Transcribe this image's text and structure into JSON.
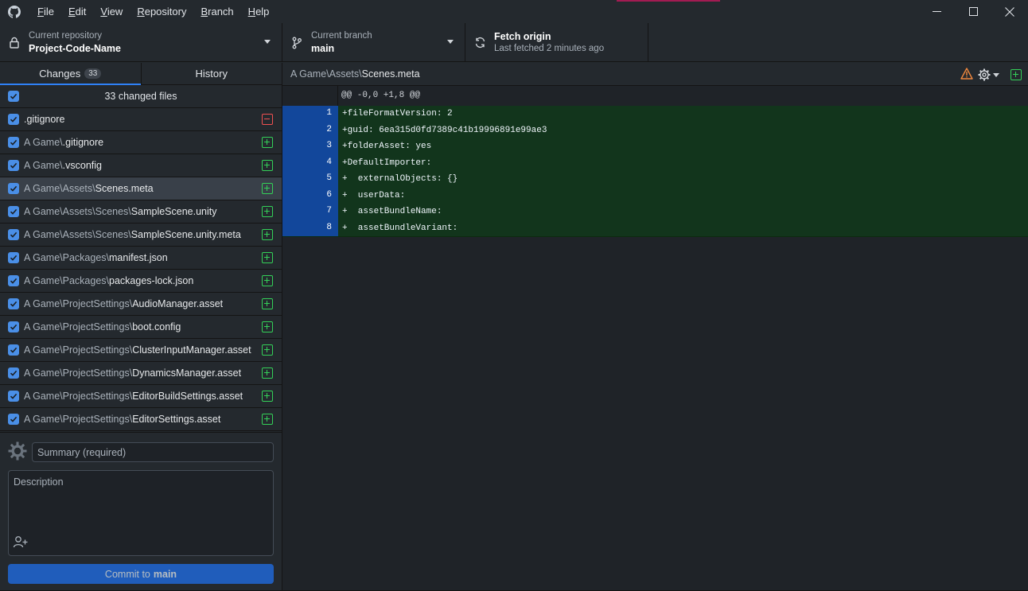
{
  "menu": {
    "items": [
      {
        "first": "F",
        "rest": "ile"
      },
      {
        "first": "E",
        "rest": "dit"
      },
      {
        "first": "V",
        "rest": "iew"
      },
      {
        "first": "R",
        "rest": "epository"
      },
      {
        "first": "B",
        "rest": "ranch"
      },
      {
        "first": "H",
        "rest": "elp"
      }
    ]
  },
  "toolbar": {
    "repo_label": "Current repository",
    "repo_value": "Project-Code-Name",
    "branch_label": "Current branch",
    "branch_value": "main",
    "fetch_label": "Fetch origin",
    "fetch_sub": "Last fetched 2 minutes ago"
  },
  "tabs": {
    "changes_label": "Changes",
    "changes_count": "33",
    "history_label": "History"
  },
  "files": {
    "header": "33 changed files",
    "items": [
      {
        "dir": "",
        "name": ".gitignore",
        "status": "deleted"
      },
      {
        "dir": "A Game\\",
        "name": ".gitignore",
        "status": "added"
      },
      {
        "dir": "A Game\\",
        "name": ".vsconfig",
        "status": "added"
      },
      {
        "dir": "A Game\\Assets\\",
        "name": "Scenes.meta",
        "status": "added",
        "selected": true
      },
      {
        "dir": "A Game\\Assets\\Scenes\\",
        "name": "SampleScene.unity",
        "status": "added"
      },
      {
        "dir": "A Game\\Assets\\Scenes\\",
        "name": "SampleScene.unity.meta",
        "status": "added"
      },
      {
        "dir": "A Game\\Packages\\",
        "name": "manifest.json",
        "status": "added"
      },
      {
        "dir": "A Game\\Packages\\",
        "name": "packages-lock.json",
        "status": "added"
      },
      {
        "dir": "A Game\\ProjectSettings\\",
        "name": "AudioManager.asset",
        "status": "added"
      },
      {
        "dir": "A Game\\ProjectSettings\\",
        "name": "boot.config",
        "status": "added"
      },
      {
        "dir": "A Game\\ProjectSettings\\",
        "name": "ClusterInputManager.asset",
        "status": "added"
      },
      {
        "dir": "A Game\\ProjectSettings\\",
        "name": "DynamicsManager.asset",
        "status": "added"
      },
      {
        "dir": "A Game\\ProjectSettings\\",
        "name": "EditorBuildSettings.asset",
        "status": "added"
      },
      {
        "dir": "A Game\\ProjectSettings\\",
        "name": "EditorSettings.asset",
        "status": "added"
      }
    ]
  },
  "commit": {
    "summary_placeholder": "Summary (required)",
    "description_placeholder": "Description",
    "button_prefix": "Commit to",
    "button_branch": "main"
  },
  "diff": {
    "path_dir": "A Game\\Assets\\",
    "path_name": "Scenes.meta",
    "hunk": "@@ -0,0 +1,8 @@",
    "lines": [
      {
        "num": "1",
        "text": "+fileFormatVersion: 2"
      },
      {
        "num": "2",
        "text": "+guid: 6ea315d0fd7389c41b19996891e99ae3"
      },
      {
        "num": "3",
        "text": "+folderAsset: yes"
      },
      {
        "num": "4",
        "text": "+DefaultImporter:"
      },
      {
        "num": "5",
        "text": "+  externalObjects: {}"
      },
      {
        "num": "6",
        "text": "+  userData:"
      },
      {
        "num": "7",
        "text": "+  assetBundleName:"
      },
      {
        "num": "8",
        "text": "+  assetBundleVariant:"
      }
    ]
  },
  "colors": {
    "accent": "#2f81f7",
    "added": "#34d058",
    "deleted": "#f05151",
    "diff_added_bg": "#12351c",
    "line_number_bg": "#12479b"
  }
}
